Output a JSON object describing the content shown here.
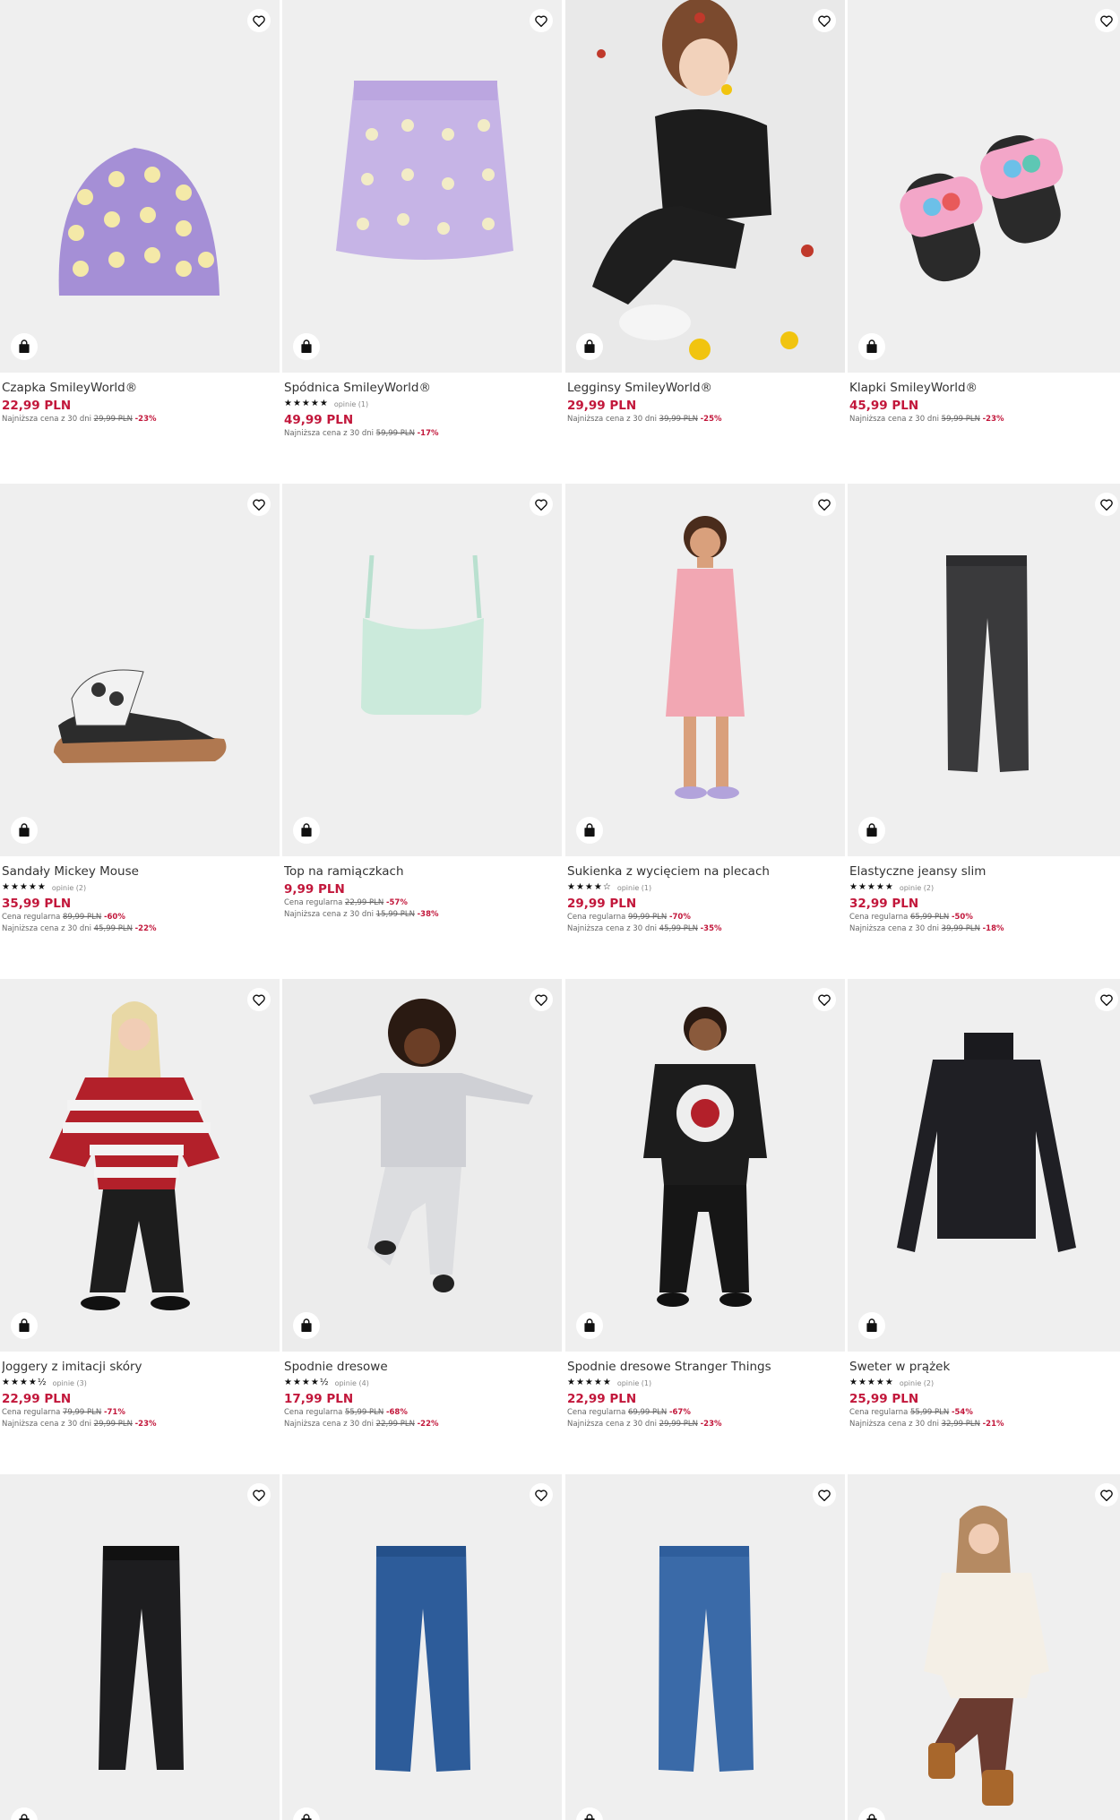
{
  "labels": {
    "regular": "Cena regularna",
    "lowest": "Najniższa cena z 30 dni"
  },
  "colors": {
    "price": "#c2173b",
    "tile_bg": "#efefef"
  },
  "products": [
    {
      "name": "Czapka SmileyWorld®",
      "price": "22,99 PLN",
      "stars": "",
      "reviews": "",
      "regular_old": "",
      "regular_pct": "",
      "lowest_old": "29,99 PLN",
      "lowest_pct": "-23%",
      "image": "beanie"
    },
    {
      "name": "Spódnica SmileyWorld®",
      "price": "49,99 PLN",
      "stars": "★★★★★",
      "reviews": "opinie (1)",
      "regular_old": "",
      "regular_pct": "",
      "lowest_old": "59,99 PLN",
      "lowest_pct": "-17%",
      "image": "skirt"
    },
    {
      "name": "Legginsy SmileyWorld®",
      "price": "29,99 PLN",
      "stars": "",
      "reviews": "",
      "regular_old": "",
      "regular_pct": "",
      "lowest_old": "39,99 PLN",
      "lowest_pct": "-25%",
      "image": "girl-leggings"
    },
    {
      "name": "Klapki SmileyWorld®",
      "price": "45,99 PLN",
      "stars": "",
      "reviews": "",
      "regular_old": "",
      "regular_pct": "",
      "lowest_old": "59,99 PLN",
      "lowest_pct": "-23%",
      "image": "slides"
    },
    {
      "name": "Sandały Mickey Mouse",
      "price": "35,99 PLN",
      "stars": "★★★★★",
      "reviews": "opinie (2)",
      "regular_old": "89,99 PLN",
      "regular_pct": "-60%",
      "lowest_old": "45,99 PLN",
      "lowest_pct": "-22%",
      "image": "sandal"
    },
    {
      "name": "Top na ramiączkach",
      "price": "9,99 PLN",
      "stars": "",
      "reviews": "",
      "regular_old": "22,99 PLN",
      "regular_pct": "-57%",
      "lowest_old": "15,99 PLN",
      "lowest_pct": "-38%",
      "image": "top"
    },
    {
      "name": "Sukienka z wycięciem na plecach",
      "price": "29,99 PLN",
      "stars": "★★★★☆",
      "reviews": "opinie (1)",
      "regular_old": "99,99 PLN",
      "regular_pct": "-70%",
      "lowest_old": "45,99 PLN",
      "lowest_pct": "-35%",
      "image": "dress-girl"
    },
    {
      "name": "Elastyczne jeansy slim",
      "price": "32,99 PLN",
      "stars": "★★★★★",
      "reviews": "opinie (2)",
      "regular_old": "65,99 PLN",
      "regular_pct": "-50%",
      "lowest_old": "39,99 PLN",
      "lowest_pct": "-18%",
      "image": "black-jeans"
    },
    {
      "name": "Joggery z imitacji skóry",
      "price": "22,99 PLN",
      "stars": "★★★★½",
      "reviews": "opinie (3)",
      "regular_old": "79,99 PLN",
      "regular_pct": "-71%",
      "lowest_old": "29,99 PLN",
      "lowest_pct": "-23%",
      "image": "stripe-girl"
    },
    {
      "name": "Spodnie dresowe",
      "price": "17,99 PLN",
      "stars": "★★★★½",
      "reviews": "opinie (4)",
      "regular_old": "55,99 PLN",
      "regular_pct": "-68%",
      "lowest_old": "22,99 PLN",
      "lowest_pct": "-22%",
      "image": "grey-girl"
    },
    {
      "name": "Spodnie dresowe Stranger Things",
      "price": "22,99 PLN",
      "stars": "★★★★★",
      "reviews": "opinie (1)",
      "regular_old": "69,99 PLN",
      "regular_pct": "-67%",
      "lowest_old": "29,99 PLN",
      "lowest_pct": "-23%",
      "image": "black-girl"
    },
    {
      "name": "Sweter w prążek",
      "price": "25,99 PLN",
      "stars": "★★★★★",
      "reviews": "opinie (2)",
      "regular_old": "55,99 PLN",
      "regular_pct": "-54%",
      "lowest_old": "32,99 PLN",
      "lowest_pct": "-21%",
      "image": "turtleneck"
    },
    {
      "name": "",
      "price": "",
      "stars": "",
      "reviews": "",
      "regular_old": "",
      "regular_pct": "",
      "lowest_old": "",
      "lowest_pct": "",
      "image": "leggings"
    },
    {
      "name": "",
      "price": "",
      "stars": "",
      "reviews": "",
      "regular_old": "",
      "regular_pct": "",
      "lowest_old": "",
      "lowest_pct": "",
      "image": "blue-jeans"
    },
    {
      "name": "",
      "price": "",
      "stars": "",
      "reviews": "",
      "regular_old": "",
      "regular_pct": "",
      "lowest_old": "",
      "lowest_pct": "",
      "image": "blue-jeans-2"
    },
    {
      "name": "",
      "price": "",
      "stars": "",
      "reviews": "",
      "regular_old": "",
      "regular_pct": "",
      "lowest_old": "",
      "lowest_pct": "",
      "image": "sweater-girl"
    }
  ]
}
